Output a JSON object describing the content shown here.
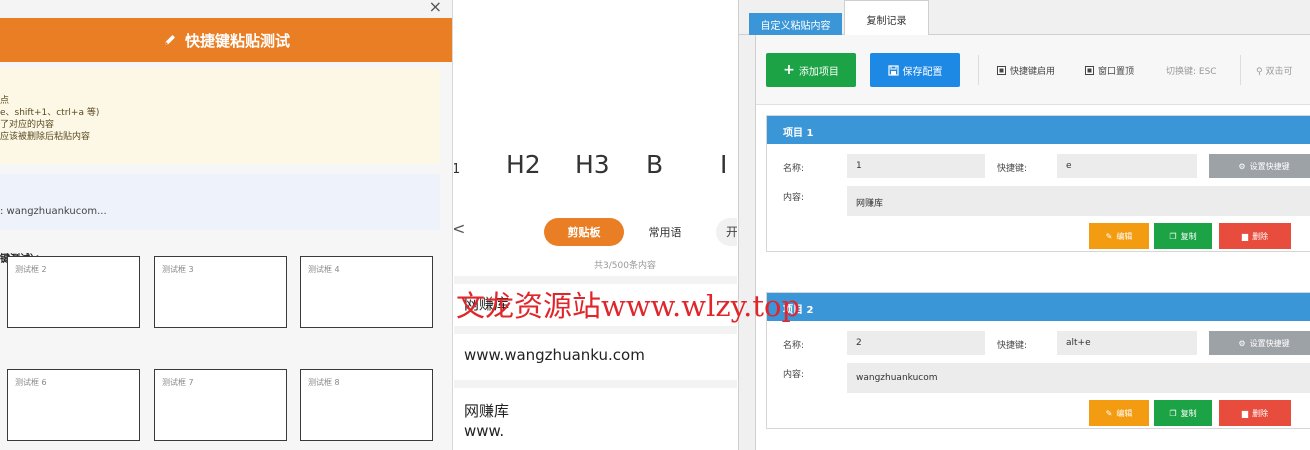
{
  "dialog": {
    "close_symbol": "×",
    "title": "快捷键粘贴测试",
    "title_icon": "pencil-icon",
    "tips": [
      "点",
      "e、shift+1、ctrl+a 等)",
      "了对应的内容",
      "应该被删除后粘贴内容"
    ],
    "info_text": ": wangzhuankucom...",
    "section_label": "键测试）：",
    "test_boxes": [
      "测试框 2",
      "测试框 3",
      "测试框 4",
      "测试框 6",
      "测试框 7",
      "测试框 8"
    ]
  },
  "clipboard_app": {
    "tools": [
      "1",
      "H2",
      "H3",
      "B",
      "I"
    ],
    "back_symbol": "<",
    "tabs": {
      "active": "剪贴板",
      "normal": "常用语",
      "partial": "开"
    },
    "count_text": "共3/500条内容",
    "items": [
      "网赚库",
      "www.wangzhuanku.com",
      "网赚库",
      "www."
    ]
  },
  "config": {
    "tabs": {
      "active": "自定义粘贴内容",
      "normal": "复制记录"
    },
    "toolbar": {
      "add_label": "添加项目",
      "save_label": "保存配置",
      "hotkey_enable_label": "快捷键启用",
      "pin_label": "窗口置顶",
      "toggle_label": "切换键: ESC",
      "dblclick_hint": "双击可"
    },
    "labels": {
      "name": "名称:",
      "hotkey": "快捷键:",
      "content": "内容:"
    },
    "buttons": {
      "set_hotkey": "设置快捷键",
      "edit": "编辑",
      "copy": "复制",
      "delete": "删除"
    },
    "items": [
      {
        "title": "项目 1",
        "name": "1",
        "hotkey": "e",
        "content": "网赚库"
      },
      {
        "title": "项目 2",
        "name": "2",
        "hotkey": "alt+e",
        "content": "wangzhuankucom"
      }
    ],
    "colors": {
      "orange": "#e97e25",
      "blue": "#3b96d8",
      "green": "#1ca345",
      "red": "#e74c3c"
    }
  },
  "watermark": "文龙资源站www.wlzy.top"
}
